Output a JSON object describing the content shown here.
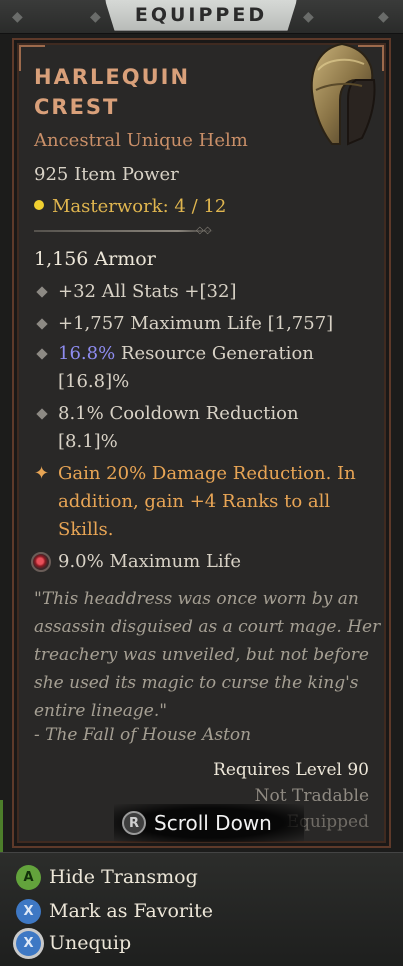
{
  "header": {
    "title": "EQUIPPED"
  },
  "item": {
    "name": "HARLEQUIN CREST",
    "type": "Ancestral Unique Helm",
    "power": "925 Item Power",
    "masterwork": "Masterwork: 4 / 12",
    "armor": "1,156 Armor",
    "icon": "helm-icon"
  },
  "affixes": {
    "a1": "+32 All Stats +[32]",
    "a2": "+1,757 Maximum Life [1,757]",
    "a3_value": "16.8%",
    "a3_text": " Resource Generation",
    "a3_range": "[16.8]%",
    "a4_text": "8.1% Cooldown Reduction",
    "a4_range": "[8.1]%",
    "unique_l1": "Gain 20% Damage Reduction. In",
    "unique_l2": "addition, gain +4 Ranks to all",
    "unique_l3": "Skills.",
    "gem": "9.0% Maximum Life"
  },
  "flavor": {
    "l1": "\"This headdress was once worn by an",
    "l2": "assassin disguised as a court mage. Her",
    "l3": "treachery was unveiled, but not before",
    "l4": "she used its magic to curse the king's",
    "l5": "entire lineage.\"",
    "source": "- The Fall of House Aston"
  },
  "requirements": {
    "level": "Requires Level 90",
    "tradable": "Not Tradable",
    "equipped": "Equipped"
  },
  "scroll_hint": {
    "button": "R",
    "label": "Scroll Down"
  },
  "actions": [
    {
      "button": "A",
      "label": "Hide Transmog"
    },
    {
      "button": "X",
      "label": "Mark as Favorite"
    },
    {
      "button": "X",
      "label": "Unequip"
    }
  ],
  "colors": {
    "unique_name": "#d9a07a",
    "legendary_affix": "#e8a555",
    "blue_value": "#8e8cf0",
    "masterwork": "#e0b64f"
  }
}
